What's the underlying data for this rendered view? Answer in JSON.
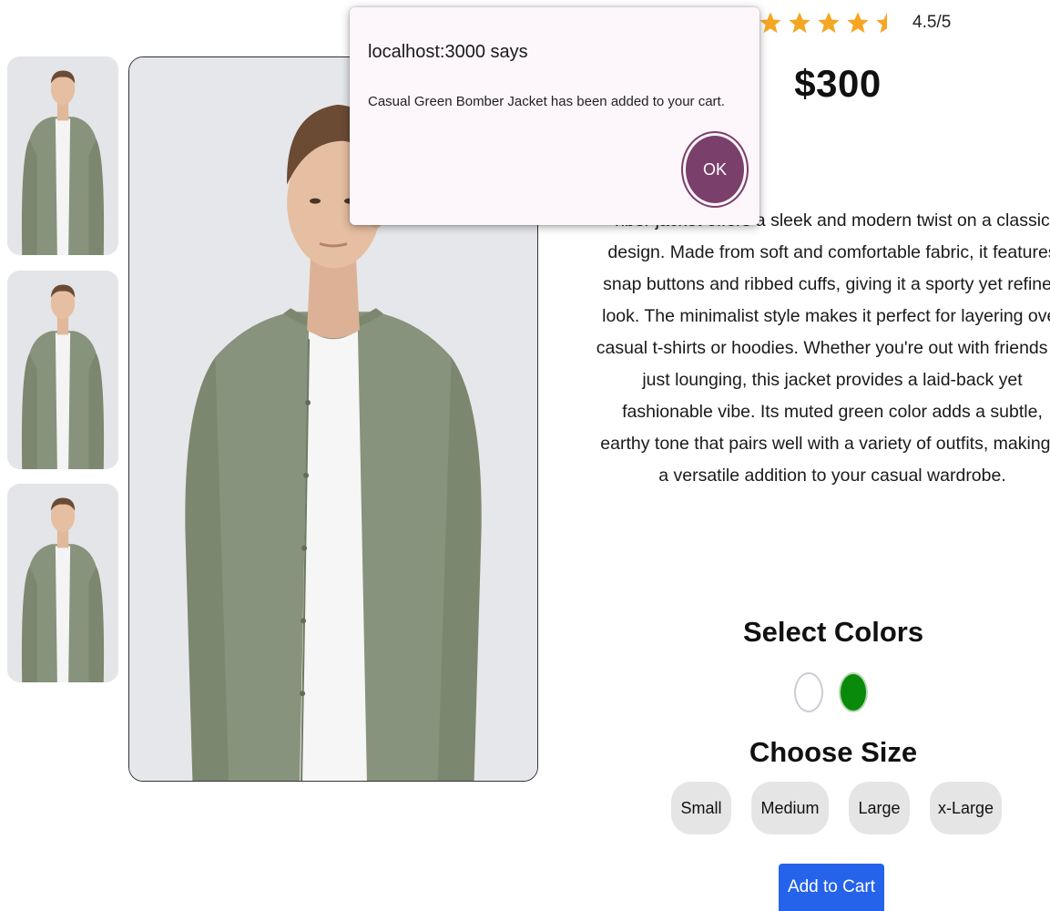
{
  "product": {
    "rating": {
      "value": 4.5,
      "max": 5,
      "text": "4.5/5"
    },
    "price": "$300",
    "description_visible": "nber jacket offers a sleek and modern twist on a classic design. Made from soft and comfortable fabric, it features snap buttons and ribbed cuffs, giving it a sporty yet refined look. The minimalist style makes it perfect for layering over casual t-shirts or hoodies. Whether you're out with friends or just lounging, this jacket provides a laid-back yet fashionable vibe. Its muted green color adds a subtle, earthy tone that pairs well with a variety of outfits, making it a versatile addition to your casual wardrobe.",
    "images": {
      "thumbnail_count": 3,
      "main_alt_icon": "product-photo-icon"
    }
  },
  "colors": {
    "title": "Select Colors",
    "options": [
      {
        "name": "white",
        "hex": "#ffffff"
      },
      {
        "name": "green",
        "hex": "#0a8a0a"
      }
    ]
  },
  "sizes": {
    "title": "Choose Size",
    "options": [
      "Small",
      "Medium",
      "Large",
      "x-Large"
    ]
  },
  "cart": {
    "add_label": "Add to Cart",
    "button_color": "#2563eb"
  },
  "dialog": {
    "title": "localhost:3000 says",
    "message": "Casual Green Bomber Jacket has been added to your cart.",
    "ok_label": "OK",
    "accent_color": "#7a3f6b"
  },
  "theme": {
    "star_color": "#f5a623",
    "jacket_color": "#87937c"
  }
}
